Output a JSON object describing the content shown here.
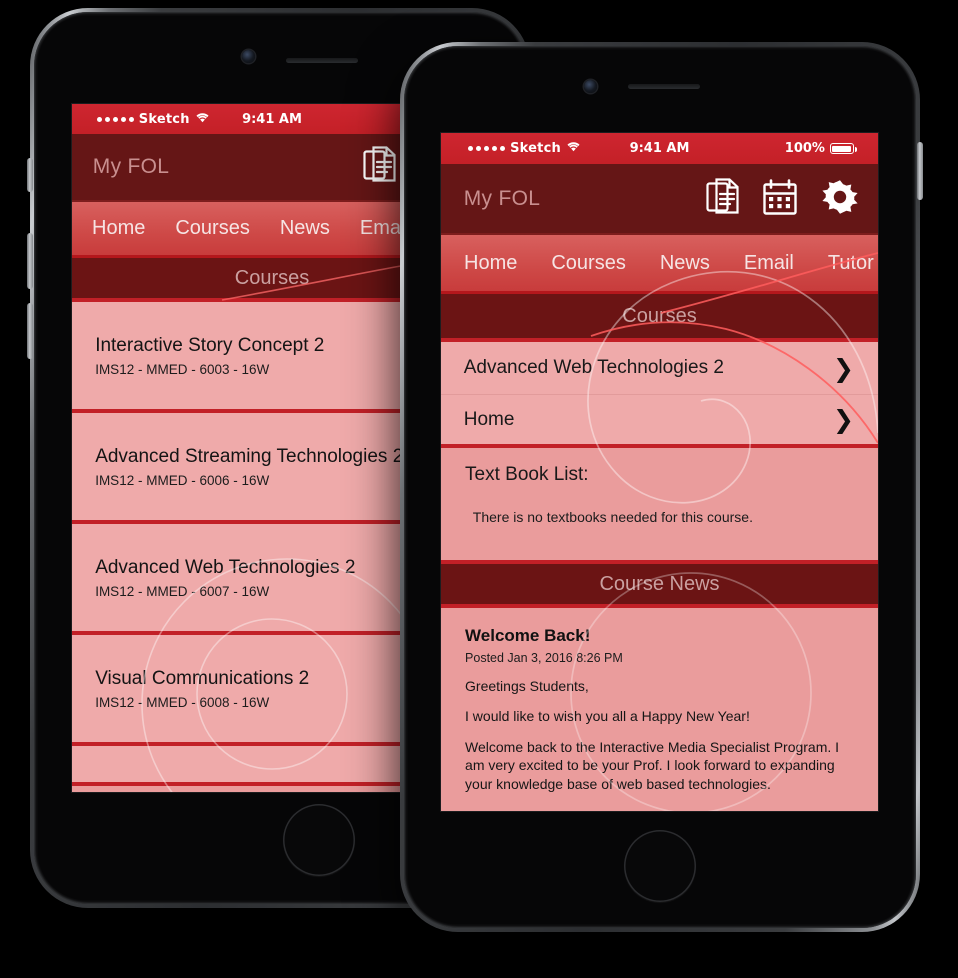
{
  "app": {
    "title": "My FOL",
    "brand_color": "#C22027",
    "header_color": "#651616",
    "nav_color": "#D3504F",
    "content_color": "#EA9C9C",
    "row_color": "#EFAAAA"
  },
  "status_bar": {
    "carrier": "Sketch",
    "time": "9:41 AM",
    "battery_percent": "100%",
    "signal_dots": 5,
    "wifi_icon": "wifi-icon",
    "battery_icon": "battery-full-icon"
  },
  "title_icons": [
    {
      "name": "documents-icon",
      "label": "Documents"
    },
    {
      "name": "calendar-icon",
      "label": "Calendar"
    },
    {
      "name": "gear-icon",
      "label": "Settings"
    }
  ],
  "nav_tabs": [
    {
      "label": "Home"
    },
    {
      "label": "Courses"
    },
    {
      "label": "News"
    },
    {
      "label": "Email"
    },
    {
      "label": "Tutor"
    }
  ],
  "front_phone": {
    "section_courses": "Courses",
    "rows": [
      {
        "label": "Advanced Web Technologies 2",
        "chevron": "❯"
      },
      {
        "label": "Home",
        "chevron": "❯"
      }
    ],
    "textbook": {
      "title": "Text Book List:",
      "body": "There is no textbooks needed for this course."
    },
    "section_news": "Course News",
    "news": {
      "headline": "Welcome Back!",
      "posted": "Posted Jan 3, 2016 8:26 PM",
      "paragraphs": [
        "Greetings Students,",
        "I would like to wish you all a Happy New Year!",
        "Welcome back to the Interactive Media Specialist Program. I am very excited to be your Prof. I look forward to expanding your knowledge base of web based technologies."
      ]
    }
  },
  "back_phone": {
    "section_courses": "Courses",
    "courses": [
      {
        "name": "Interactive Story Concept 2",
        "code": "IMS12 - MMED - 6003 - 16W"
      },
      {
        "name": "Advanced Streaming Technologies 2",
        "code": "IMS12 - MMED - 6006 - 16W"
      },
      {
        "name": "Advanced Web Technologies 2",
        "code": "IMS12 - MMED - 6007 - 16W"
      },
      {
        "name": "Visual Communications 2",
        "code": "IMS12 - MMED - 6008 - 16W"
      }
    ]
  }
}
